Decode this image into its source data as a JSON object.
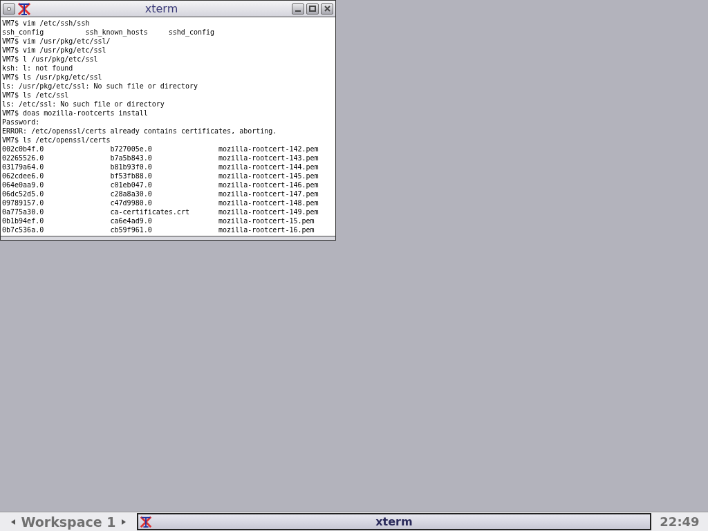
{
  "window": {
    "title": "xterm"
  },
  "terminal": {
    "lines": [
      {
        "kind": "text",
        "cells": [
          "VM7$ vim /etc/ssh/ssh"
        ]
      },
      {
        "kind": "narrow",
        "cells": [
          "ssh_config",
          "ssh_known_hosts",
          "sshd_config"
        ]
      },
      {
        "kind": "text",
        "cells": [
          "VM7$ vim /usr/pkg/etc/ssl/"
        ]
      },
      {
        "kind": "text",
        "cells": [
          "VM7$ vim /usr/pkg/etc/ssl"
        ]
      },
      {
        "kind": "text",
        "cells": [
          "VM7$ l /usr/pkg/etc/ssl"
        ]
      },
      {
        "kind": "text",
        "cells": [
          "ksh: l: not found"
        ]
      },
      {
        "kind": "text",
        "cells": [
          "VM7$ ls /usr/pkg/etc/ssl"
        ]
      },
      {
        "kind": "text",
        "cells": [
          "ls: /usr/pkg/etc/ssl: No such file or directory"
        ]
      },
      {
        "kind": "text",
        "cells": [
          "VM7$ ls /etc/ssl"
        ]
      },
      {
        "kind": "text",
        "cells": [
          "ls: /etc/ssl: No such file or directory"
        ]
      },
      {
        "kind": "text",
        "cells": [
          "VM7$ doas mozilla-rootcerts install"
        ]
      },
      {
        "kind": "text",
        "cells": [
          "Password:"
        ]
      },
      {
        "kind": "text",
        "cells": [
          "ERROR: /etc/openssl/certs already contains certificates, aborting."
        ]
      },
      {
        "kind": "text",
        "cells": [
          "VM7$ ls /etc/openssl/certs"
        ]
      },
      {
        "kind": "wide",
        "cells": [
          "002c0b4f.0",
          "b727005e.0",
          "mozilla-rootcert-142.pem"
        ]
      },
      {
        "kind": "wide",
        "cells": [
          "02265526.0",
          "b7a5b843.0",
          "mozilla-rootcert-143.pem"
        ]
      },
      {
        "kind": "wide",
        "cells": [
          "03179a64.0",
          "b81b93f0.0",
          "mozilla-rootcert-144.pem"
        ]
      },
      {
        "kind": "wide",
        "cells": [
          "062cdee6.0",
          "bf53fb88.0",
          "mozilla-rootcert-145.pem"
        ]
      },
      {
        "kind": "wide",
        "cells": [
          "064e0aa9.0",
          "c01eb047.0",
          "mozilla-rootcert-146.pem"
        ]
      },
      {
        "kind": "wide",
        "cells": [
          "06dc52d5.0",
          "c28a8a30.0",
          "mozilla-rootcert-147.pem"
        ]
      },
      {
        "kind": "wide",
        "cells": [
          "09789157.0",
          "c47d9980.0",
          "mozilla-rootcert-148.pem"
        ]
      },
      {
        "kind": "wide",
        "cells": [
          "0a775a30.0",
          "ca-certificates.crt",
          "mozilla-rootcert-149.pem"
        ]
      },
      {
        "kind": "wide",
        "cells": [
          "0b1b94ef.0",
          "ca6e4ad9.0",
          "mozilla-rootcert-15.pem"
        ]
      },
      {
        "kind": "wide",
        "cells": [
          "0b7c536a.0",
          "cb59f961.0",
          "mozilla-rootcert-16.pem"
        ]
      }
    ]
  },
  "taskbar": {
    "workspace": "Workspace 1",
    "tasks": [
      {
        "title": "xterm",
        "selected": true
      }
    ],
    "clock": "22:49"
  }
}
